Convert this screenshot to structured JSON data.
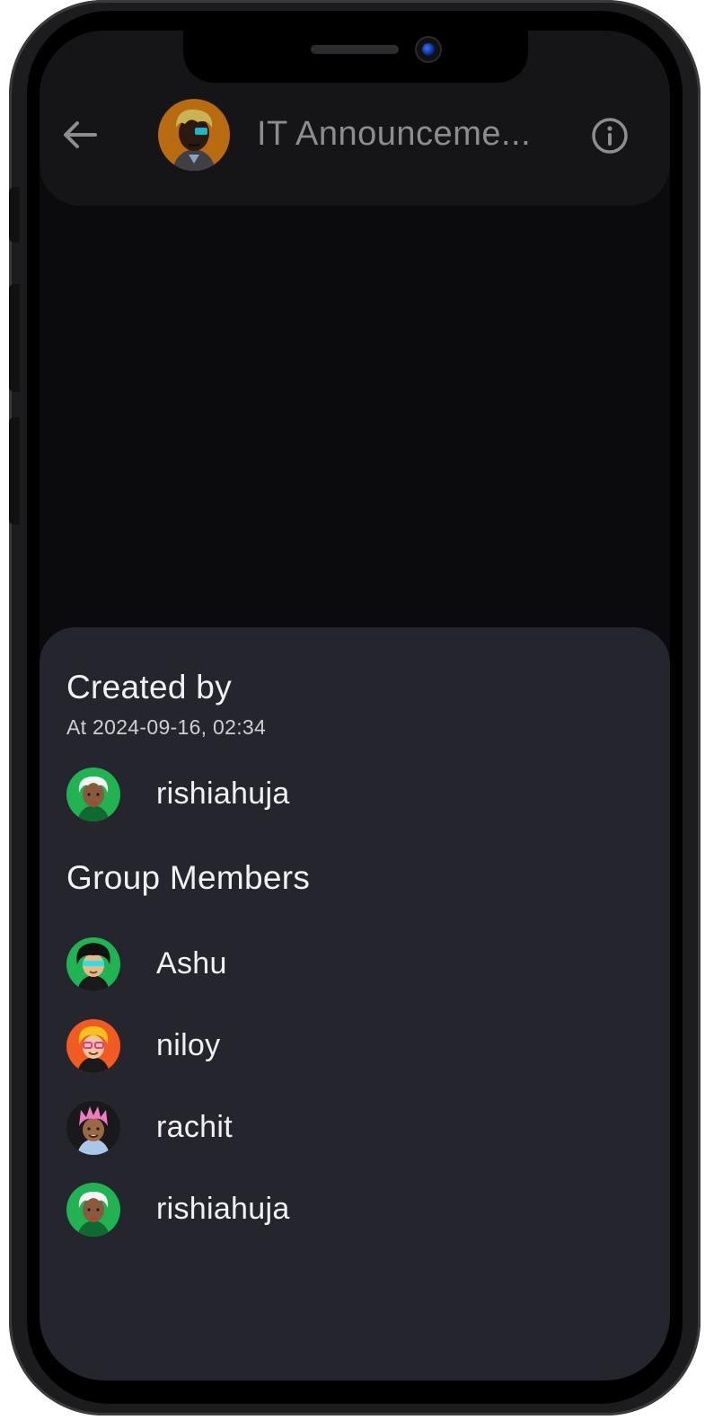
{
  "header": {
    "title": "IT Announceme...",
    "back_icon": "arrow-left-icon",
    "info_icon": "info-circle-icon",
    "avatar_bg": "#b86b0f"
  },
  "created": {
    "heading": "Created by",
    "timestamp": "At 2024-09-16, 02:34",
    "creator": {
      "name": "rishiahuja",
      "avatar_bg": "#1fb451"
    }
  },
  "members": {
    "heading": "Group Members",
    "items": [
      {
        "name": "Ashu",
        "avatar_bg": "#1fb451"
      },
      {
        "name": "niloy",
        "avatar_bg": "#f25a22"
      },
      {
        "name": "rachit",
        "avatar_bg": "#19191b"
      },
      {
        "name": "rishiahuja",
        "avatar_bg": "#1fb451"
      }
    ]
  },
  "colors": {
    "screen_bg": "#0b0b0d",
    "header_bg": "#151518",
    "sheet_bg": "#24252d",
    "text_primary": "#f1f1f3",
    "text_muted": "#8d8d90"
  }
}
